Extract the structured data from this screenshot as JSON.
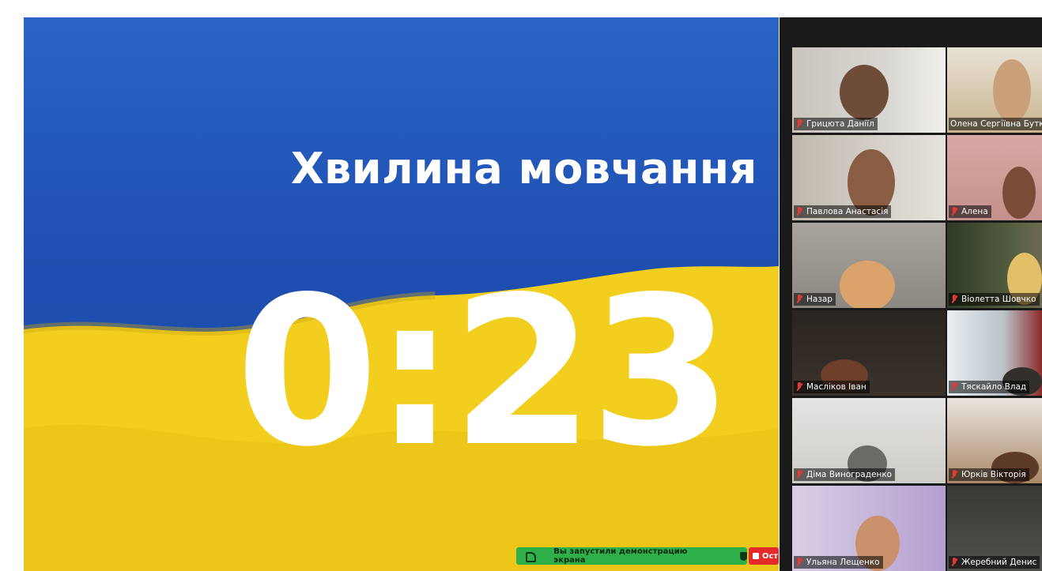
{
  "slide": {
    "title": "Хвилина мовчання",
    "timer": "0:23"
  },
  "participants": [
    {
      "name": "Грицюта Даніїл",
      "muted": true
    },
    {
      "name": "Олена Сергіївна Бутко",
      "muted": false
    },
    {
      "name": "Павлова Анастасія",
      "muted": true
    },
    {
      "name": "Алена",
      "muted": true
    },
    {
      "name": "Назар",
      "muted": true
    },
    {
      "name": "Віолетта Шовчко",
      "muted": true
    },
    {
      "name": "Масліков Іван",
      "muted": true
    },
    {
      "name": "Тяскайло Влад",
      "muted": true
    },
    {
      "name": "Діма Винограденко",
      "muted": true
    },
    {
      "name": "Юрків Вікторія",
      "muted": true,
      "active": true
    },
    {
      "name": "Ульяна Лещенко",
      "muted": true
    },
    {
      "name": "Жеребний Денис",
      "muted": true
    }
  ],
  "share_bar": {
    "text": "Вы запустили демонстрацию экрана",
    "stop_label": "Ост"
  },
  "colors": {
    "flag_blue": "#1e4fb0",
    "flag_yellow": "#f2cf1f",
    "share_green": "#2eaf4a",
    "stop_red": "#e52a2a",
    "active_speaker": "#2bd36b",
    "muted_icon": "#e53935"
  },
  "icons": [
    "muted-mic-icon",
    "screen-share-icon",
    "shield-icon",
    "stop-share-icon"
  ]
}
